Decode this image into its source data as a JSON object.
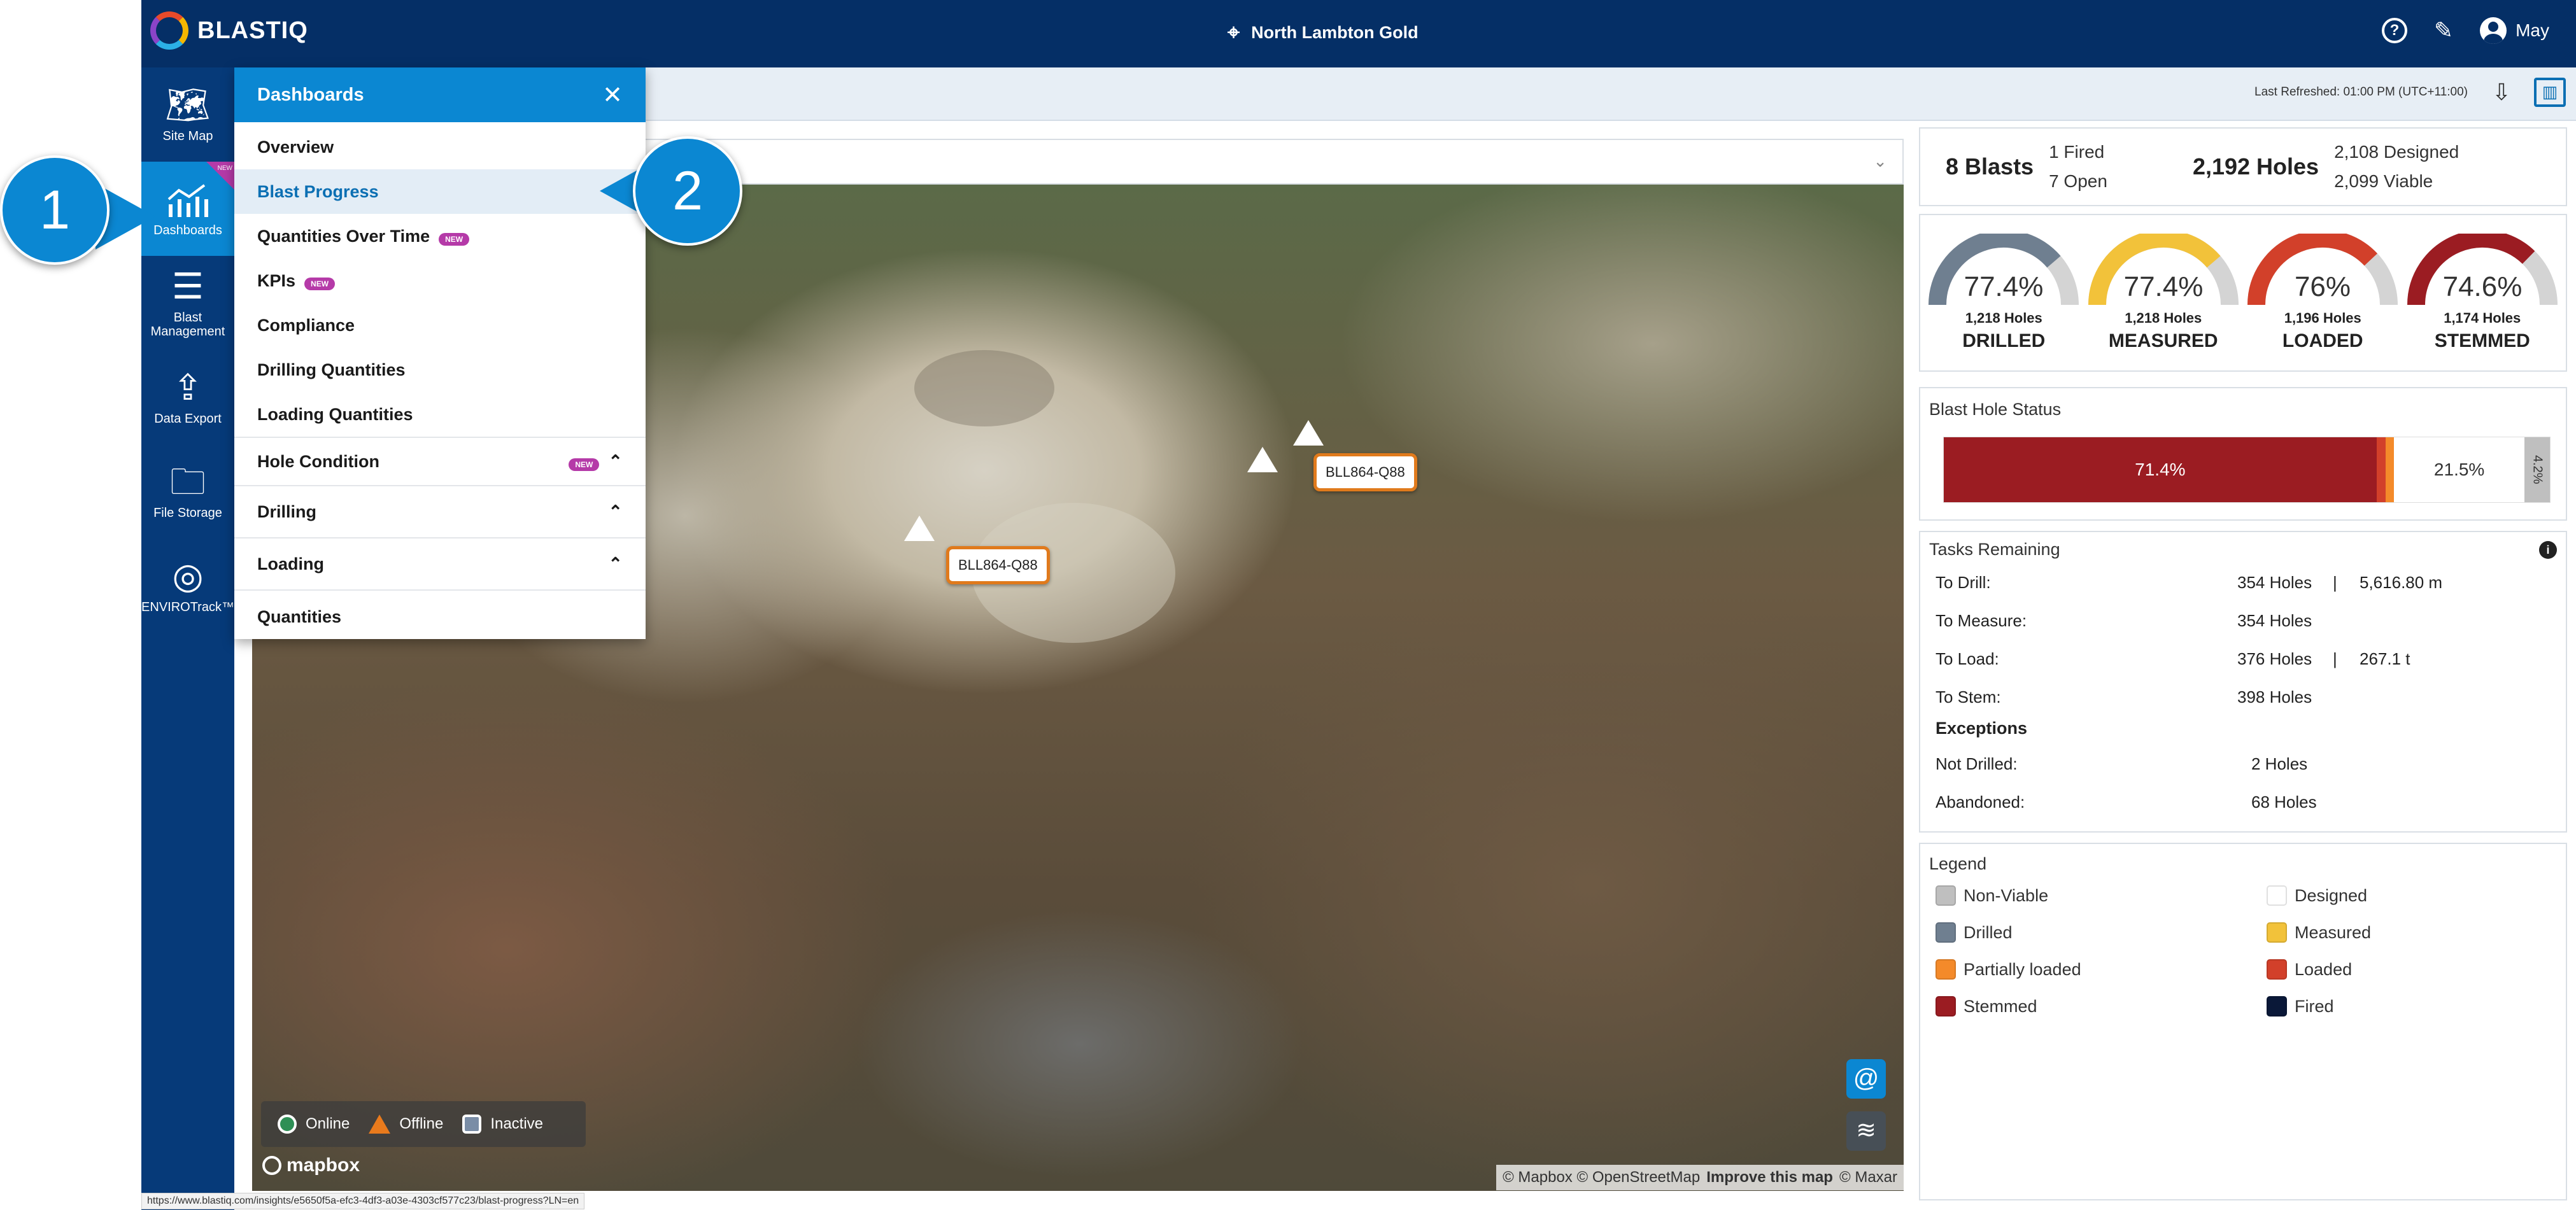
{
  "app": {
    "name": "BLASTIQ",
    "site": "North Lambton Gold",
    "user": "May"
  },
  "rail": [
    {
      "id": "site-map",
      "label": "Site Map",
      "icon": "map-icon"
    },
    {
      "id": "dashboards",
      "label": "Dashboards",
      "icon": "chart-icon",
      "badge": "NEW"
    },
    {
      "id": "blast-management",
      "label": "Blast\nManagement",
      "icon": "list-icon"
    },
    {
      "id": "data-export",
      "label": "Data Export",
      "icon": "upload-icon"
    },
    {
      "id": "file-storage",
      "label": "File Storage",
      "icon": "folder-icon"
    },
    {
      "id": "envirotrack",
      "label": "ENVIROTrack™",
      "icon": "target-icon"
    }
  ],
  "subbar": {
    "last_refreshed": "Last Refreshed: 01:00 PM (UTC+11:00)"
  },
  "dashboards_menu": {
    "title": "Dashboards",
    "items": [
      {
        "label": "Overview"
      },
      {
        "label": "Blast Progress",
        "selected": true
      },
      {
        "label": "Quantities Over Time",
        "badge": "NEW"
      },
      {
        "label": "KPIs",
        "badge": "NEW"
      },
      {
        "label": "Compliance"
      },
      {
        "label": "Drilling Quantities"
      },
      {
        "label": "Loading Quantities"
      },
      {
        "label": "Hole Condition",
        "badge": "NEW",
        "expandable": true
      },
      {
        "label": "Drilling",
        "expandable": true
      },
      {
        "label": "Loading",
        "expandable": true
      },
      {
        "label": "Quantities"
      }
    ]
  },
  "callouts": [
    "1",
    "2"
  ],
  "map": {
    "markers": [
      {
        "label": "BLL864-Q88"
      },
      {
        "label": "BLL864-Q88"
      }
    ],
    "status_legend": [
      {
        "label": "Online",
        "color": "#2e8f55"
      },
      {
        "label": "Offline",
        "color": "#e97a1c"
      },
      {
        "label": "Inactive",
        "color": "#7a8da6"
      }
    ],
    "brand": "mapbox",
    "attribution_a": "© Mapbox © OpenStreetMap",
    "attribution_b": "Improve this map",
    "attribution_c": "© Maxar"
  },
  "summary": {
    "blasts_count": "8 Blasts",
    "fired": "1 Fired",
    "open": "7 Open",
    "holes_count": "2,192 Holes",
    "designed": "2,108 Designed",
    "viable": "2,099 Viable"
  },
  "gauges": [
    {
      "value": 77.4,
      "display": "77.4%",
      "holes": "1,218 Holes",
      "label": "DRILLED",
      "color": "#6f7f90"
    },
    {
      "value": 77.4,
      "display": "77.4%",
      "holes": "1,218 Holes",
      "label": "MEASURED",
      "color": "#f2c23a"
    },
    {
      "value": 76,
      "display": "76%",
      "holes": "1,196 Holes",
      "label": "LOADED",
      "color": "#d2402a"
    },
    {
      "value": 74.6,
      "display": "74.6%",
      "holes": "1,174 Holes",
      "label": "STEMMED",
      "color": "#9b1c22"
    }
  ],
  "hole_status": {
    "title": "Blast Hole Status",
    "segments": [
      {
        "value": 71.4,
        "label": "71.4%",
        "color": "#9b1c22"
      },
      {
        "value": 1.5,
        "label": "",
        "color": "#d2402a"
      },
      {
        "value": 1.4,
        "label": "",
        "color": "#f48a2a"
      },
      {
        "value": 21.5,
        "label": "21.5%",
        "color": "#ffffff"
      },
      {
        "value": 4.2,
        "label": "4.2%",
        "color": "#bfbfbf"
      }
    ]
  },
  "tasks": {
    "title": "Tasks Remaining",
    "rows": [
      {
        "label": "To Drill:",
        "holes": "354 Holes",
        "extra": "5,616.80 m"
      },
      {
        "label": "To Measure:",
        "holes": "354 Holes",
        "extra": ""
      },
      {
        "label": "To Load:",
        "holes": "376 Holes",
        "extra": "267.1 t"
      },
      {
        "label": "To Stem:",
        "holes": "398 Holes",
        "extra": ""
      }
    ],
    "exceptions_title": "Exceptions",
    "exceptions": [
      {
        "label": "Not Drilled:",
        "holes": "2 Holes"
      },
      {
        "label": "Abandoned:",
        "holes": "68 Holes"
      }
    ]
  },
  "legend": {
    "title": "Legend",
    "items": [
      {
        "label": "Non-Viable",
        "color": "#bfbfbf"
      },
      {
        "label": "Designed",
        "color": "#ffffff"
      },
      {
        "label": "Drilled",
        "color": "#6f7f90"
      },
      {
        "label": "Measured",
        "color": "#f2c23a"
      },
      {
        "label": "Partially loaded",
        "color": "#f48a2a"
      },
      {
        "label": "Loaded",
        "color": "#d2402a"
      },
      {
        "label": "Stemmed",
        "color": "#9b1c22"
      },
      {
        "label": "Fired",
        "color": "#0a1838"
      }
    ]
  },
  "status_url": "https://www.blastiq.com/insights/e5650f5a-efc3-4df3-a03e-4303cf577c23/blast-progress?LN=en"
}
